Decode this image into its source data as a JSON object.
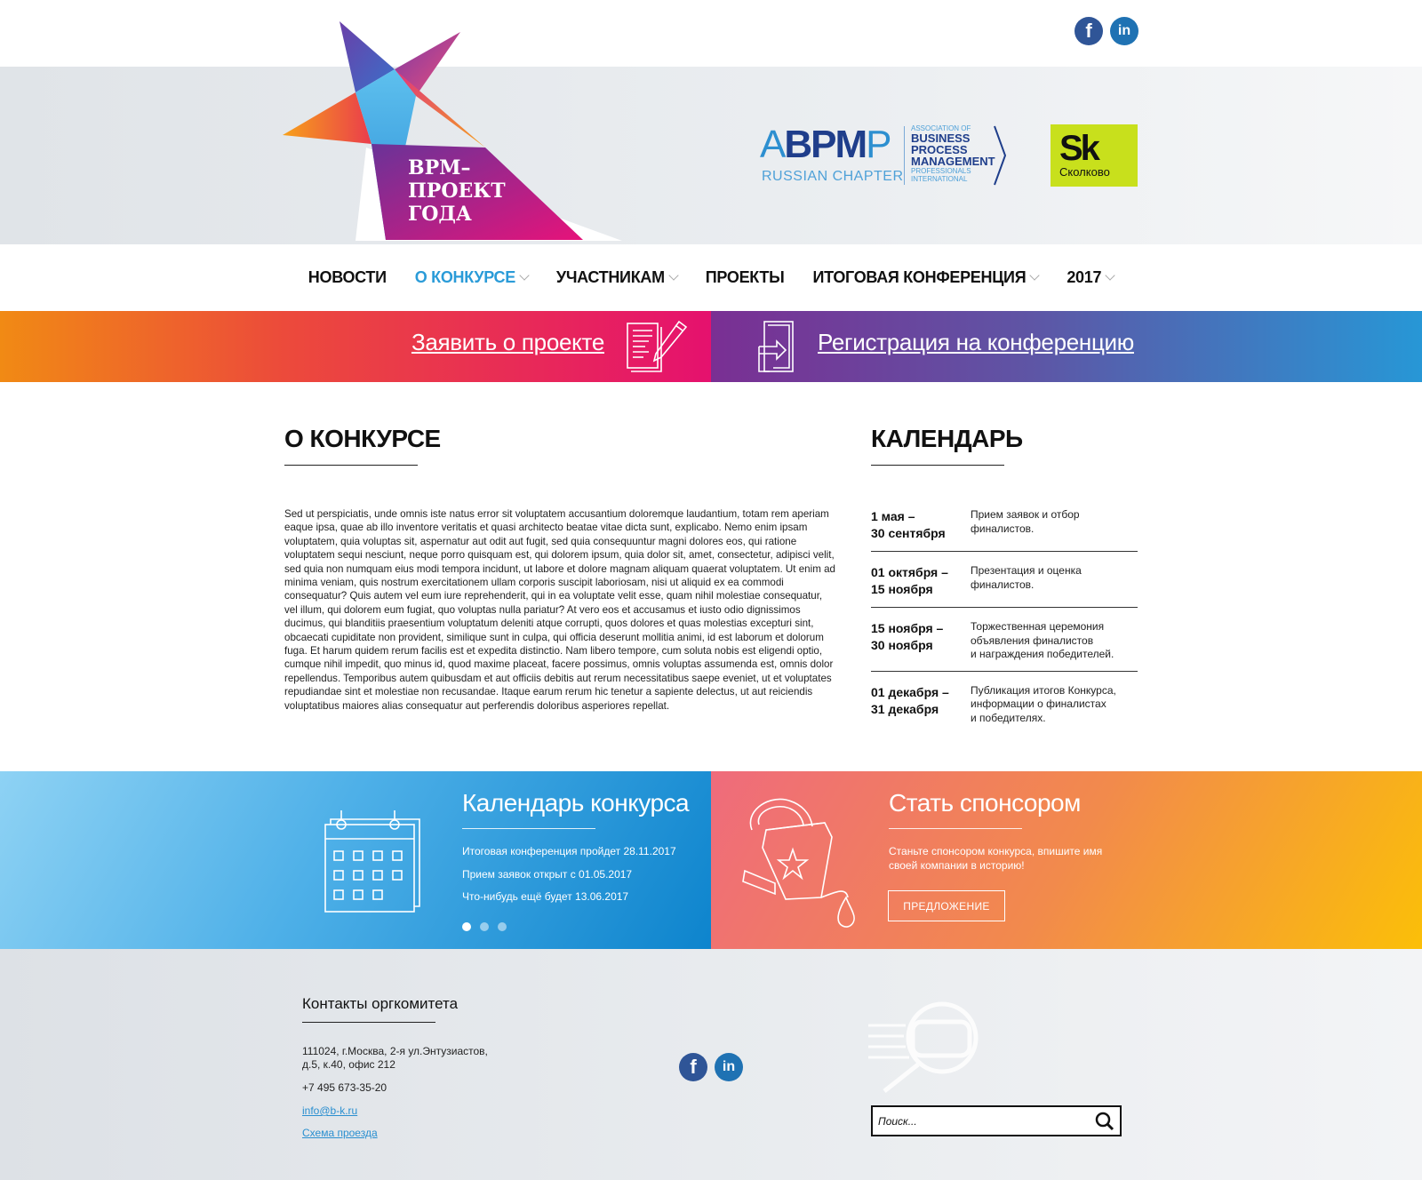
{
  "header": {
    "logo_text_lines": [
      "BPM–",
      "ПРОЕКТ",
      "ГОДА"
    ],
    "social": {
      "facebook_icon": "facebook-icon",
      "linkedin_icon": "linkedin-icon"
    },
    "partner_abpmp": {
      "big_a": "A",
      "big_bpm": "BPM",
      "big_p": "P",
      "chapter": "RUSSIAN CHAPTER",
      "small_assoc": "ASSOCIATION OF",
      "small_business": "BUSINESS",
      "small_process": "PROCESS",
      "small_management": "MANAGEMENT",
      "small_professionals": "PROFESSIONALS",
      "small_international": "INTERNATIONAL"
    },
    "partner_sk": {
      "mark": "Sk",
      "word": "Сколково",
      "color": "#c8e01c"
    }
  },
  "nav": {
    "items": [
      {
        "label": "НОВОСТИ",
        "has_dropdown": false
      },
      {
        "label": "О КОНКУРСЕ",
        "has_dropdown": true,
        "active": true
      },
      {
        "label": "УЧАСТНИКАМ",
        "has_dropdown": true
      },
      {
        "label": "ПРОЕКТЫ",
        "has_dropdown": false
      },
      {
        "label": "ИТОГОВАЯ КОНФЕРЕНЦИЯ",
        "has_dropdown": true
      },
      {
        "label": "2017",
        "has_dropdown": true
      }
    ],
    "active_color": "#2a9bd8"
  },
  "banner": {
    "apply_label": "Заявить о проекте",
    "register_label": "Регистрация на конференцию"
  },
  "about": {
    "title": "О КОНКУРСЕ",
    "text": "Sed ut perspiciatis, unde omnis iste natus error sit voluptatem accusantium doloremque laudantium, totam rem aperiam eaque ipsa, quae ab illo inventore veritatis et quasi architecto beatae vitae dicta sunt, explicabo. Nemo enim ipsam voluptatem, quia voluptas sit, aspernatur aut odit aut fugit, sed quia consequuntur magni dolores eos, qui ratione voluptatem sequi nesciunt, neque porro quisquam est, qui dolorem ipsum, quia dolor sit, amet, consectetur, adipisci velit, sed quia non numquam eius modi tempora incidunt, ut labore et dolore magnam aliquam quaerat voluptatem. Ut enim ad minima veniam, quis nostrum exercitationem ullam corporis suscipit laboriosam, nisi ut aliquid ex ea commodi consequatur? Quis autem vel eum iure reprehenderit, qui in ea voluptate velit esse, quam nihil molestiae consequatur, vel illum, qui dolorem eum fugiat, quo voluptas nulla pariatur? At vero eos et accusamus et iusto odio dignissimos ducimus, qui blanditiis praesentium voluptatum deleniti atque corrupti, quos dolores et quas molestias excepturi sint, obcaecati cupiditate non provident, similique sunt in culpa, qui officia deserunt mollitia animi, id est laborum et dolorum fuga. Et harum quidem rerum facilis est et expedita distinctio. Nam libero tempore, cum soluta nobis est eligendi optio, cumque nihil impedit, quo minus id, quod maxime placeat, facere possimus, omnis voluptas assumenda est, omnis dolor repellendus. Temporibus autem quibusdam et aut officiis debitis aut rerum necessitatibus saepe eveniet, ut et voluptates repudiandae sint et molestiae non recusandae. Itaque earum rerum hic tenetur a sapiente delectus, ut aut reiciendis voluptatibus maiores alias consequatur aut perferendis doloribus asperiores repellat."
  },
  "calendar": {
    "title": "КАЛЕНДАРЬ",
    "rows": [
      {
        "date_from": "1 мая –",
        "date_to": "30 сентября",
        "desc": [
          "Прием заявок и отбор",
          "финалистов."
        ]
      },
      {
        "date_from": "01 октября –",
        "date_to": "15 ноября",
        "desc": [
          "Презентация и оценка",
          "финалистов."
        ]
      },
      {
        "date_from": "15 ноября –",
        "date_to": "30 ноября",
        "desc": [
          "Торжественная церемония",
          "объявления финалистов",
          "и награждения победителей."
        ]
      },
      {
        "date_from": "01 декабря –",
        "date_to": "31 декабря",
        "desc": [
          "Публикация итогов Конкурса,",
          "информации о финалистах",
          "и победителях."
        ]
      }
    ]
  },
  "promo_calendar": {
    "title": "Календарь конкурса",
    "items": [
      "Итоговая конференция пройдет 28.11.2017",
      "Прием заявок открыт с 01.05.2017",
      "Что-нибудь ещё будет 13.06.2017"
    ],
    "active_dot": 0,
    "dot_count": 3
  },
  "promo_sponsor": {
    "title": "Стать спонсором",
    "text_lines": [
      "Станьте спонсором конкурса, впишите имя",
      "своей компании в историю!"
    ],
    "button_label": "ПРЕДЛОЖЕНИЕ"
  },
  "footer": {
    "title": "Контакты оргкомитета",
    "address_lines": [
      "111024, г.Москва, 2-я ул.Энтузиастов,",
      "д.5, к.40, офис 212"
    ],
    "phone": "+7 495 673-35-20",
    "email": "info@b-k.ru",
    "map_link": "Схема проезда",
    "search_placeholder": "Поиск..."
  }
}
